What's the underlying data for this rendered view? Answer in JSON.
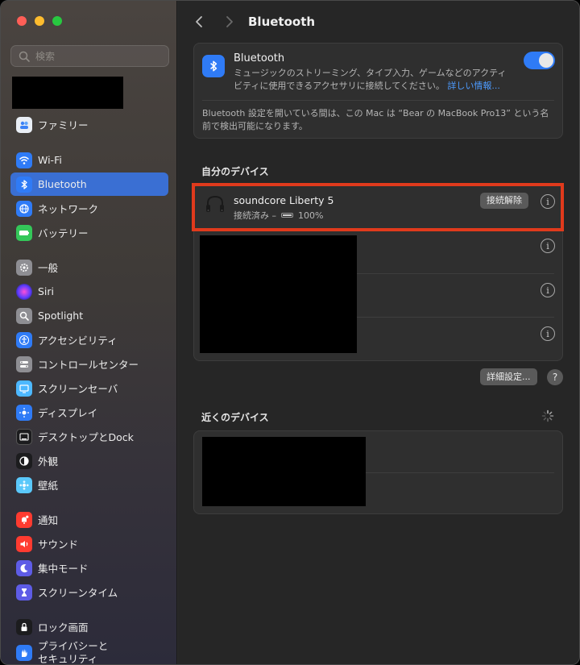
{
  "sidebar": {
    "search_placeholder": "検索",
    "items": [
      {
        "label": "ファミリー",
        "icon": "family-icon"
      },
      {
        "label": "Wi-Fi",
        "icon": "wifi-icon"
      },
      {
        "label": "Bluetooth",
        "icon": "bluetooth-icon"
      },
      {
        "label": "ネットワーク",
        "icon": "network-icon"
      },
      {
        "label": "バッテリー",
        "icon": "battery-icon"
      },
      {
        "label": "一般",
        "icon": "gear-icon"
      },
      {
        "label": "Siri",
        "icon": "siri-icon"
      },
      {
        "label": "Spotlight",
        "icon": "spotlight-icon"
      },
      {
        "label": "アクセシビリティ",
        "icon": "accessibility-icon"
      },
      {
        "label": "コントロールセンター",
        "icon": "control-center-icon"
      },
      {
        "label": "スクリーンセーバ",
        "icon": "screensaver-icon"
      },
      {
        "label": "ディスプレイ",
        "icon": "display-icon"
      },
      {
        "label": "デスクトップとDock",
        "icon": "desktop-dock-icon"
      },
      {
        "label": "外観",
        "icon": "appearance-icon"
      },
      {
        "label": "壁紙",
        "icon": "wallpaper-icon"
      },
      {
        "label": "通知",
        "icon": "notifications-icon"
      },
      {
        "label": "サウンド",
        "icon": "sound-icon"
      },
      {
        "label": "集中モード",
        "icon": "focus-icon"
      },
      {
        "label": "スクリーンタイム",
        "icon": "screen-time-icon"
      },
      {
        "label": "ロック画面",
        "icon": "lock-screen-icon"
      },
      {
        "label": "プライバシーと\nセキュリティ",
        "icon": "privacy-hand-icon"
      }
    ],
    "active": "Bluetooth"
  },
  "main": {
    "title": "Bluetooth",
    "bluetooth": {
      "title": "Bluetooth",
      "description": "ミュージックのストリーミング、タイプ入力、ゲームなどのアクティビティに使用できるアクセサリに接続してください。",
      "link": "詳しい情報...",
      "enabled": true,
      "note": "Bluetooth 設定を開いている間は、この Mac は “Bear の MacBook Pro13” という名前で検出可能になります。"
    },
    "my_devices": {
      "title": "自分のデバイス",
      "device": {
        "name": "soundcore Liberty 5",
        "status": "接続済み –",
        "battery": "100%",
        "disconnect_label": "接続解除"
      }
    },
    "advanced_label": "詳細設定...",
    "help_label": "?",
    "nearby": {
      "title": "近くのデバイス"
    }
  },
  "colors": {
    "accent": "#2f7bf6",
    "highlight": "#e03a1c"
  }
}
